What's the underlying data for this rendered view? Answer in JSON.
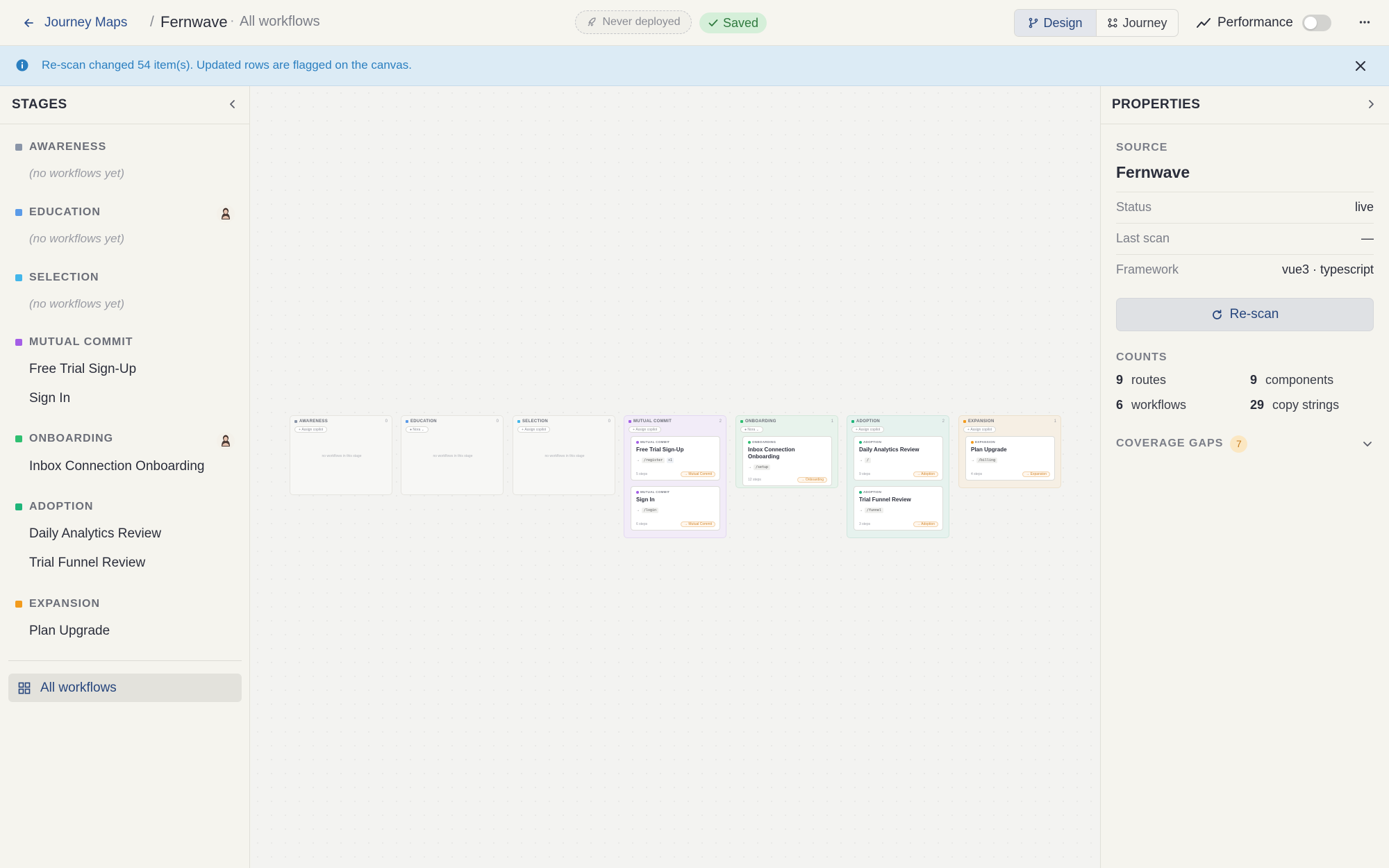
{
  "header": {
    "back_label": "Journey Maps",
    "separator": "/",
    "project": "Fernwave",
    "dot": "·",
    "view": "All workflows",
    "deploy_status": "Never deployed",
    "save_status": "Saved",
    "mode_design": "Design",
    "mode_journey": "Journey",
    "performance_label": "Performance",
    "more_icon": "ellipsis-icon"
  },
  "banner": {
    "text": "Re-scan changed 54 item(s). Updated rows are flagged on the canvas."
  },
  "sidebar": {
    "title": "STAGES",
    "empty_text": "(no workflows yet)",
    "all_workflows_label": "All workflows",
    "stages": [
      {
        "name": "AWARENESS",
        "color": "#8a95a8",
        "workflows": []
      },
      {
        "name": "EDUCATION",
        "color": "#5b9be8",
        "workflows": []
      },
      {
        "name": "SELECTION",
        "color": "#43b6ea",
        "workflows": []
      },
      {
        "name": "MUTUAL COMMIT",
        "color": "#a45ee6",
        "workflows": [
          "Free Trial Sign-Up",
          "Sign In"
        ]
      },
      {
        "name": "ONBOARDING",
        "color": "#2fbf71",
        "workflows": [
          "Inbox Connection Onboarding"
        ]
      },
      {
        "name": "ADOPTION",
        "color": "#1fb57a",
        "workflows": [
          "Daily Analytics Review",
          "Trial Funnel Review"
        ]
      },
      {
        "name": "EXPANSION",
        "color": "#f29b1d",
        "workflows": [
          "Plan Upgrade"
        ]
      }
    ]
  },
  "canvas": {
    "assign_label": "Assign copilot",
    "empty_label": "no workflows in this stage",
    "assignee": "Nora",
    "columns": [
      {
        "name": "AWARENESS",
        "count": "0"
      },
      {
        "name": "EDUCATION",
        "count": "0"
      },
      {
        "name": "SELECTION",
        "count": "0"
      },
      {
        "name": "MUTUAL COMMIT",
        "count": "2"
      },
      {
        "name": "ONBOARDING",
        "count": "1"
      },
      {
        "name": "ADOPTION",
        "count": "2"
      },
      {
        "name": "EXPANSION",
        "count": "1"
      }
    ],
    "cards": [
      {
        "stage": "MUTUAL COMMIT",
        "name": "Free Trial Sign-Up",
        "route": "/register",
        "extra": "+1",
        "steps": "5 steps",
        "badge": "Mutual Commit"
      },
      {
        "stage": "MUTUAL COMMIT",
        "name": "Sign In",
        "route": "/login",
        "steps": "6 steps",
        "badge": "Mutual Commit"
      },
      {
        "stage": "ONBOARDING",
        "name": "Inbox Connection Onboarding",
        "route": "/setup",
        "steps": "12 steps",
        "badge": "Onboarding"
      },
      {
        "stage": "ADOPTION",
        "name": "Daily Analytics Review",
        "route": "/",
        "steps": "9 steps",
        "badge": "Adoption"
      },
      {
        "stage": "ADOPTION",
        "name": "Trial Funnel Review",
        "route": "/funnel",
        "steps": "3 steps",
        "badge": "Adoption"
      },
      {
        "stage": "EXPANSION",
        "name": "Plan Upgrade",
        "route": "/billing",
        "steps": "4 steps",
        "badge": "Expansion"
      }
    ]
  },
  "properties": {
    "title": "PROPERTIES",
    "source_label": "SOURCE",
    "source_name": "Fernwave",
    "status_key": "Status",
    "status_value": "live",
    "last_scan_key": "Last scan",
    "last_scan_value": "—",
    "framework_key": "Framework",
    "framework_value": "vue3 · typescript",
    "rescan_label": "Re-scan",
    "counts_label": "COUNTS",
    "routes_n": "9",
    "routes_label": "routes",
    "components_n": "9",
    "components_label": "components",
    "workflows_n": "6",
    "workflows_label": "workflows",
    "copy_n": "29",
    "copy_label": "copy strings",
    "gaps_label": "COVERAGE GAPS",
    "gaps_count": "7"
  }
}
